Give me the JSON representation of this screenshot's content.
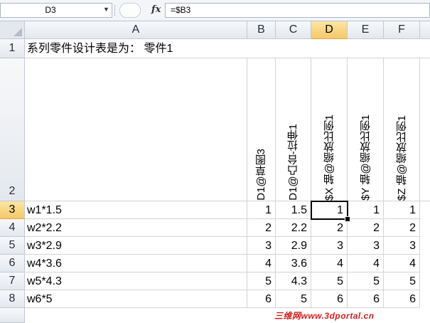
{
  "formula_bar": {
    "name_box": "D3",
    "fx_label": "fx",
    "formula": "=$B3"
  },
  "columns": [
    "A",
    "B",
    "C",
    "D",
    "E",
    "F"
  ],
  "rows": [
    "1",
    "2",
    "3",
    "4",
    "5",
    "6",
    "7",
    "8"
  ],
  "row1_title": "系列零件设计表是为： 零件1",
  "headers": {
    "B": "D1@草图3",
    "C": "D1@凸台-拉伸1",
    "D": "$X 轴@缩放比例1",
    "E": "$Y 轴@缩放比例1",
    "F": "$Z 轴@缩放比例1"
  },
  "table": [
    {
      "A": "w1*1.5",
      "B": "1",
      "C": "1.5",
      "D": "1",
      "E": "1",
      "F": "1"
    },
    {
      "A": "w2*2.2",
      "B": "2",
      "C": "2.2",
      "D": "2",
      "E": "2",
      "F": "2"
    },
    {
      "A": "w3*2.9",
      "B": "3",
      "C": "2.9",
      "D": "3",
      "E": "3",
      "F": "3"
    },
    {
      "A": "w4*3.6",
      "B": "4",
      "C": "3.6",
      "D": "4",
      "E": "4",
      "F": "4"
    },
    {
      "A": "w5*4.3",
      "B": "5",
      "C": "4.3",
      "D": "5",
      "E": "5",
      "F": "5"
    },
    {
      "A": "w6*5",
      "B": "6",
      "C": "5",
      "D": "6",
      "E": "6",
      "F": "6"
    }
  ],
  "active_cell": "D3",
  "watermark": "三维网www.3dportal.cn"
}
